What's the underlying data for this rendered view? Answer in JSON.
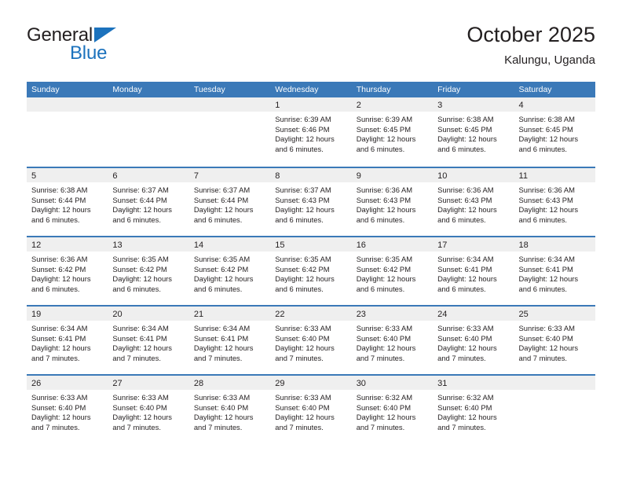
{
  "logo": {
    "word_top": "General",
    "word_bottom": "Blue",
    "triangle_icon": "triangle-icon",
    "color_dark": "#231f20",
    "color_blue": "#1c72bd"
  },
  "header": {
    "title": "October 2025",
    "subtitle": "Kalungu, Uganda"
  },
  "theme": {
    "header_blue": "#3b79b8",
    "daynum_band": "#efefef",
    "text": "#231f20",
    "cell_background": "#ffffff"
  },
  "calendar": {
    "day_headers": [
      "Sunday",
      "Monday",
      "Tuesday",
      "Wednesday",
      "Thursday",
      "Friday",
      "Saturday"
    ],
    "weeks": [
      [
        {
          "day": "",
          "lines": []
        },
        {
          "day": "",
          "lines": []
        },
        {
          "day": "",
          "lines": []
        },
        {
          "day": "1",
          "lines": [
            "Sunrise: 6:39 AM",
            "Sunset: 6:46 PM",
            "Daylight: 12 hours",
            "and 6 minutes."
          ]
        },
        {
          "day": "2",
          "lines": [
            "Sunrise: 6:39 AM",
            "Sunset: 6:45 PM",
            "Daylight: 12 hours",
            "and 6 minutes."
          ]
        },
        {
          "day": "3",
          "lines": [
            "Sunrise: 6:38 AM",
            "Sunset: 6:45 PM",
            "Daylight: 12 hours",
            "and 6 minutes."
          ]
        },
        {
          "day": "4",
          "lines": [
            "Sunrise: 6:38 AM",
            "Sunset: 6:45 PM",
            "Daylight: 12 hours",
            "and 6 minutes."
          ]
        }
      ],
      [
        {
          "day": "5",
          "lines": [
            "Sunrise: 6:38 AM",
            "Sunset: 6:44 PM",
            "Daylight: 12 hours",
            "and 6 minutes."
          ]
        },
        {
          "day": "6",
          "lines": [
            "Sunrise: 6:37 AM",
            "Sunset: 6:44 PM",
            "Daylight: 12 hours",
            "and 6 minutes."
          ]
        },
        {
          "day": "7",
          "lines": [
            "Sunrise: 6:37 AM",
            "Sunset: 6:44 PM",
            "Daylight: 12 hours",
            "and 6 minutes."
          ]
        },
        {
          "day": "8",
          "lines": [
            "Sunrise: 6:37 AM",
            "Sunset: 6:43 PM",
            "Daylight: 12 hours",
            "and 6 minutes."
          ]
        },
        {
          "day": "9",
          "lines": [
            "Sunrise: 6:36 AM",
            "Sunset: 6:43 PM",
            "Daylight: 12 hours",
            "and 6 minutes."
          ]
        },
        {
          "day": "10",
          "lines": [
            "Sunrise: 6:36 AM",
            "Sunset: 6:43 PM",
            "Daylight: 12 hours",
            "and 6 minutes."
          ]
        },
        {
          "day": "11",
          "lines": [
            "Sunrise: 6:36 AM",
            "Sunset: 6:43 PM",
            "Daylight: 12 hours",
            "and 6 minutes."
          ]
        }
      ],
      [
        {
          "day": "12",
          "lines": [
            "Sunrise: 6:36 AM",
            "Sunset: 6:42 PM",
            "Daylight: 12 hours",
            "and 6 minutes."
          ]
        },
        {
          "day": "13",
          "lines": [
            "Sunrise: 6:35 AM",
            "Sunset: 6:42 PM",
            "Daylight: 12 hours",
            "and 6 minutes."
          ]
        },
        {
          "day": "14",
          "lines": [
            "Sunrise: 6:35 AM",
            "Sunset: 6:42 PM",
            "Daylight: 12 hours",
            "and 6 minutes."
          ]
        },
        {
          "day": "15",
          "lines": [
            "Sunrise: 6:35 AM",
            "Sunset: 6:42 PM",
            "Daylight: 12 hours",
            "and 6 minutes."
          ]
        },
        {
          "day": "16",
          "lines": [
            "Sunrise: 6:35 AM",
            "Sunset: 6:42 PM",
            "Daylight: 12 hours",
            "and 6 minutes."
          ]
        },
        {
          "day": "17",
          "lines": [
            "Sunrise: 6:34 AM",
            "Sunset: 6:41 PM",
            "Daylight: 12 hours",
            "and 6 minutes."
          ]
        },
        {
          "day": "18",
          "lines": [
            "Sunrise: 6:34 AM",
            "Sunset: 6:41 PM",
            "Daylight: 12 hours",
            "and 6 minutes."
          ]
        }
      ],
      [
        {
          "day": "19",
          "lines": [
            "Sunrise: 6:34 AM",
            "Sunset: 6:41 PM",
            "Daylight: 12 hours",
            "and 7 minutes."
          ]
        },
        {
          "day": "20",
          "lines": [
            "Sunrise: 6:34 AM",
            "Sunset: 6:41 PM",
            "Daylight: 12 hours",
            "and 7 minutes."
          ]
        },
        {
          "day": "21",
          "lines": [
            "Sunrise: 6:34 AM",
            "Sunset: 6:41 PM",
            "Daylight: 12 hours",
            "and 7 minutes."
          ]
        },
        {
          "day": "22",
          "lines": [
            "Sunrise: 6:33 AM",
            "Sunset: 6:40 PM",
            "Daylight: 12 hours",
            "and 7 minutes."
          ]
        },
        {
          "day": "23",
          "lines": [
            "Sunrise: 6:33 AM",
            "Sunset: 6:40 PM",
            "Daylight: 12 hours",
            "and 7 minutes."
          ]
        },
        {
          "day": "24",
          "lines": [
            "Sunrise: 6:33 AM",
            "Sunset: 6:40 PM",
            "Daylight: 12 hours",
            "and 7 minutes."
          ]
        },
        {
          "day": "25",
          "lines": [
            "Sunrise: 6:33 AM",
            "Sunset: 6:40 PM",
            "Daylight: 12 hours",
            "and 7 minutes."
          ]
        }
      ],
      [
        {
          "day": "26",
          "lines": [
            "Sunrise: 6:33 AM",
            "Sunset: 6:40 PM",
            "Daylight: 12 hours",
            "and 7 minutes."
          ]
        },
        {
          "day": "27",
          "lines": [
            "Sunrise: 6:33 AM",
            "Sunset: 6:40 PM",
            "Daylight: 12 hours",
            "and 7 minutes."
          ]
        },
        {
          "day": "28",
          "lines": [
            "Sunrise: 6:33 AM",
            "Sunset: 6:40 PM",
            "Daylight: 12 hours",
            "and 7 minutes."
          ]
        },
        {
          "day": "29",
          "lines": [
            "Sunrise: 6:33 AM",
            "Sunset: 6:40 PM",
            "Daylight: 12 hours",
            "and 7 minutes."
          ]
        },
        {
          "day": "30",
          "lines": [
            "Sunrise: 6:32 AM",
            "Sunset: 6:40 PM",
            "Daylight: 12 hours",
            "and 7 minutes."
          ]
        },
        {
          "day": "31",
          "lines": [
            "Sunrise: 6:32 AM",
            "Sunset: 6:40 PM",
            "Daylight: 12 hours",
            "and 7 minutes."
          ]
        },
        {
          "day": "",
          "lines": []
        }
      ]
    ]
  }
}
